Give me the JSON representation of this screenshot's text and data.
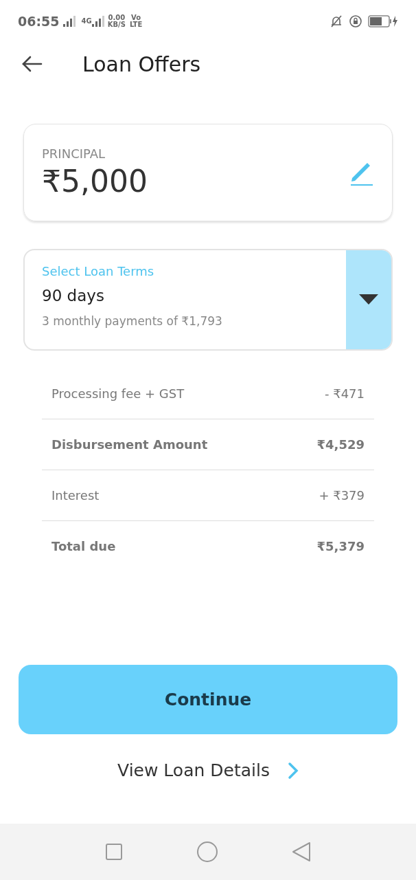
{
  "status_bar": {
    "time": "06:55",
    "network": "4G",
    "speed": "0.00",
    "speed_unit": "KB/S",
    "volte_top": "Vo",
    "volte_bottom": "LTE"
  },
  "header": {
    "title": "Loan Offers"
  },
  "principal": {
    "label": "PRINCIPAL",
    "amount": "₹5,000"
  },
  "loan_terms": {
    "label": "Select Loan Terms",
    "value": "90 days",
    "detail": "3 monthly payments of ₹1,793"
  },
  "breakdown": [
    {
      "label": "Processing fee + GST",
      "value": "- ₹471",
      "bold": false
    },
    {
      "label": "Disbursement Amount",
      "value": "₹4,529",
      "bold": true
    },
    {
      "label": "Interest",
      "value": "+ ₹379",
      "bold": false
    },
    {
      "label": "Total due",
      "value": "₹5,379",
      "bold": true
    }
  ],
  "continue_button": "Continue",
  "details_link": "View Loan Details"
}
